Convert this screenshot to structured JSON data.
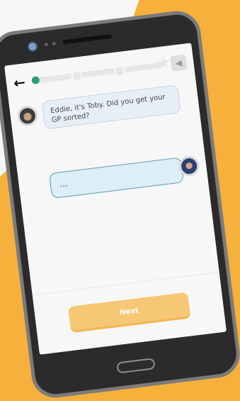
{
  "topbar": {
    "back_icon": "arrow-left-icon",
    "sound_icon": "speaker-icon",
    "progress_value": 0.02
  },
  "messages": [
    {
      "sender": "Toby",
      "text": "Eddie, it's Toby. Did you get your GP sorted?"
    },
    {
      "sender": "Eddie",
      "text": "…"
    }
  ],
  "footer": {
    "next_label": "Next"
  },
  "colors": {
    "background": "#f5b13b",
    "phone_frame": "#2b2b2b",
    "progress_accent": "#2f9e76",
    "next_button": "#f6c774",
    "input_border": "#5c9ab3"
  }
}
